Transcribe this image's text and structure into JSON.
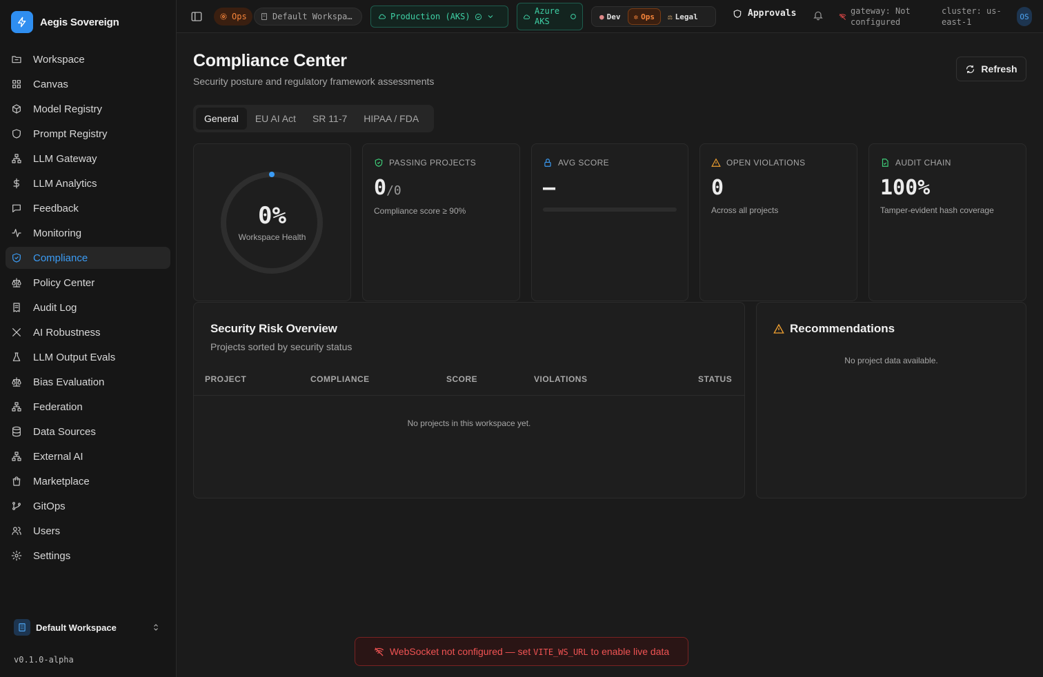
{
  "app": {
    "name": "Aegis Sovereign",
    "version": "v0.1.0-alpha"
  },
  "sidebar": {
    "items": [
      {
        "label": "Workspace",
        "icon": "folder-icon"
      },
      {
        "label": "Canvas",
        "icon": "grid-icon"
      },
      {
        "label": "Model Registry",
        "icon": "cube-icon"
      },
      {
        "label": "Prompt Registry",
        "icon": "shield-icon"
      },
      {
        "label": "LLM Gateway",
        "icon": "network-icon"
      },
      {
        "label": "LLM Analytics",
        "icon": "dollar-icon"
      },
      {
        "label": "Feedback",
        "icon": "message-icon"
      },
      {
        "label": "Monitoring",
        "icon": "activity-icon"
      },
      {
        "label": "Compliance",
        "icon": "shield-check-icon"
      },
      {
        "label": "Policy Center",
        "icon": "scale-icon"
      },
      {
        "label": "Audit Log",
        "icon": "receipt-icon"
      },
      {
        "label": "AI Robustness",
        "icon": "swords-icon"
      },
      {
        "label": "LLM Output Evals",
        "icon": "flask-icon"
      },
      {
        "label": "Bias Evaluation",
        "icon": "scale-icon"
      },
      {
        "label": "Federation",
        "icon": "network-icon"
      },
      {
        "label": "Data Sources",
        "icon": "database-icon"
      },
      {
        "label": "External AI",
        "icon": "network-icon"
      },
      {
        "label": "Marketplace",
        "icon": "bag-icon"
      },
      {
        "label": "GitOps",
        "icon": "git-branch-icon"
      },
      {
        "label": "Users",
        "icon": "users-icon"
      },
      {
        "label": "Settings",
        "icon": "gear-icon"
      }
    ],
    "active": "Compliance",
    "workspace_name": "Default Workspace"
  },
  "topbar": {
    "ops_badge": "Ops",
    "workspace_pill": "Default Workspa…",
    "environment": "Production (AKS)",
    "azure_line1": "Azure",
    "azure_line2": "AKS",
    "roles": [
      "Dev",
      "Ops",
      "Legal"
    ],
    "active_role": "Ops",
    "approvals": "Approvals",
    "gateway_line1": "gateway: Not",
    "gateway_line2": "configured",
    "cluster_line1": "cluster: us-",
    "cluster_line2": "east-1",
    "avatar": "OS"
  },
  "page": {
    "title": "Compliance Center",
    "subtitle": "Security posture and regulatory framework assessments",
    "refresh": "Refresh",
    "tabs": [
      "General",
      "EU AI Act",
      "SR 11-7",
      "HIPAA / FDA"
    ],
    "active_tab": "General"
  },
  "health": {
    "value": "0%",
    "label": "Workspace Health",
    "fraction": 0
  },
  "stats": {
    "passing": {
      "label": "Passing Projects",
      "value": "0",
      "total": "/0",
      "note": "Compliance score ≥ 90%"
    },
    "avg": {
      "label": "Avg Score",
      "value": "—",
      "progress": 0
    },
    "violations": {
      "label": "Open Violations",
      "value": "0",
      "note": "Across all projects"
    },
    "audit": {
      "label": "Audit Chain",
      "value": "100%",
      "note": "Tamper-evident hash coverage"
    }
  },
  "risk": {
    "title": "Security Risk Overview",
    "subtitle": "Projects sorted by security status",
    "columns": [
      "PROJECT",
      "COMPLIANCE",
      "SCORE",
      "VIOLATIONS",
      "STATUS"
    ],
    "empty": "No projects in this workspace yet."
  },
  "recommendations": {
    "title": "Recommendations",
    "empty": "No project data available."
  },
  "toast": {
    "prefix": "WebSocket not configured — set ",
    "code": "VITE_WS_URL",
    "suffix": " to enable live data"
  },
  "colors": {
    "accent": "#3b9cf5",
    "ops": "#f7853a",
    "env": "#3fd1a6",
    "danger": "#f05353",
    "warn": "#f0a030",
    "ok": "#3fd17a"
  }
}
